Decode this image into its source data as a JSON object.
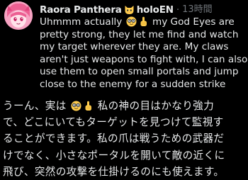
{
  "post": {
    "author": {
      "display_name": "Raora Panthera",
      "badge_icon": "cat-face-emoji-icon",
      "handle": "holoEN",
      "separator": "·",
      "timestamp": "13時間"
    },
    "text_en": {
      "line1_start": "Uhmmm actually",
      "line1_emoji1": "nerd-face-emoji-icon",
      "line1_emoji2": "pointing-up-emoji-icon",
      "line1_end": "my God Eyes are",
      "line2": "pretty strong, they let me find and watch",
      "line3": "my target wherever they are. My claws",
      "line4": "aren't just weapons to fight with, I can also",
      "line5": "use them to open small portals and jump",
      "line6": "close to the enemy for a sudden strike"
    },
    "text_ja": {
      "line1_start": "うーん、実は",
      "line1_end": "私の神の目はかなり強力",
      "line2": "で、どこにいてもターゲットを見つけて監視す",
      "line3": "ることができます。私の爪は戦うための武器だ",
      "line4": "けでなく、小さなポータルを開いて敵の近くに",
      "line5": "飛び、突然の攻撃を仕掛けるのにも使えます。"
    }
  },
  "colors": {
    "background": "#000000",
    "text": "#e7e9ea",
    "muted": "#71767b",
    "emoji_yellow": "#ffcc4d"
  }
}
